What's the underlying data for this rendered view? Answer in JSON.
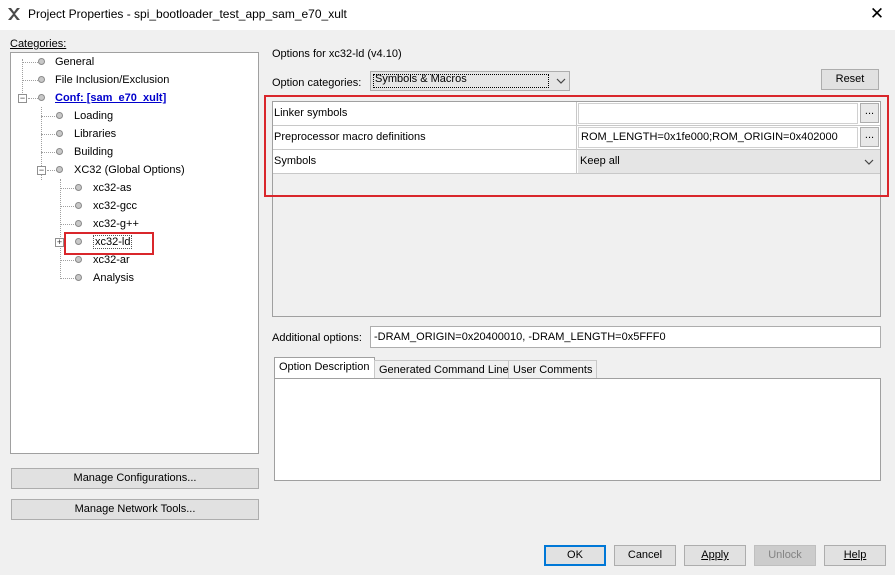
{
  "window": {
    "title": "Project Properties - spi_bootloader_test_app_sam_e70_xult",
    "close_glyph": "✕"
  },
  "categories": {
    "label": "Categories:",
    "items": [
      {
        "label": "General"
      },
      {
        "label": "File Inclusion/Exclusion"
      },
      {
        "label": "Conf: [sam_e70_xult]"
      },
      {
        "label": "Loading"
      },
      {
        "label": "Libraries"
      },
      {
        "label": "Building"
      },
      {
        "label": "XC32 (Global Options)"
      },
      {
        "label": "xc32-as"
      },
      {
        "label": "xc32-gcc"
      },
      {
        "label": "xc32-g++"
      },
      {
        "label": "xc32-ld"
      },
      {
        "label": "xc32-ar"
      },
      {
        "label": "Analysis"
      }
    ],
    "expander_minus": "−",
    "expander_plus": "+"
  },
  "left_buttons": {
    "manage_configurations": "Manage Configurations...",
    "manage_network_tools": "Manage Network Tools..."
  },
  "options": {
    "options_for": "Options for xc32-ld (v4.10)",
    "option_categories_label": "Option categories:",
    "option_categories_value": "Symbols & Macros",
    "reset_label": "Reset",
    "rows": [
      {
        "name": "Linker symbols",
        "value": ""
      },
      {
        "name": "Preprocessor macro definitions",
        "value": "ROM_LENGTH=0x1fe000;ROM_ORIGIN=0x402000"
      },
      {
        "name": "Symbols",
        "value": "Keep all"
      }
    ],
    "ellipsis": "...",
    "additional_label": "Additional options:",
    "additional_value": "-DRAM_ORIGIN=0x20400010, -DRAM_LENGTH=0x5FFF0"
  },
  "tabs": [
    {
      "label": "Option Description"
    },
    {
      "label": "Generated Command Line"
    },
    {
      "label": "User Comments"
    }
  ],
  "footer": {
    "ok": "OK",
    "cancel": "Cancel",
    "apply": "Apply",
    "unlock": "Unlock",
    "help": "Help"
  },
  "colors": {
    "highlight_red": "#d9262b",
    "link_blue": "#0000cc",
    "default_button_border": "#0078d7"
  },
  "icons": {
    "app": "mplab-x-icon",
    "dropdown": "chevron-down-icon",
    "tree_node": "circle-node-icon"
  }
}
